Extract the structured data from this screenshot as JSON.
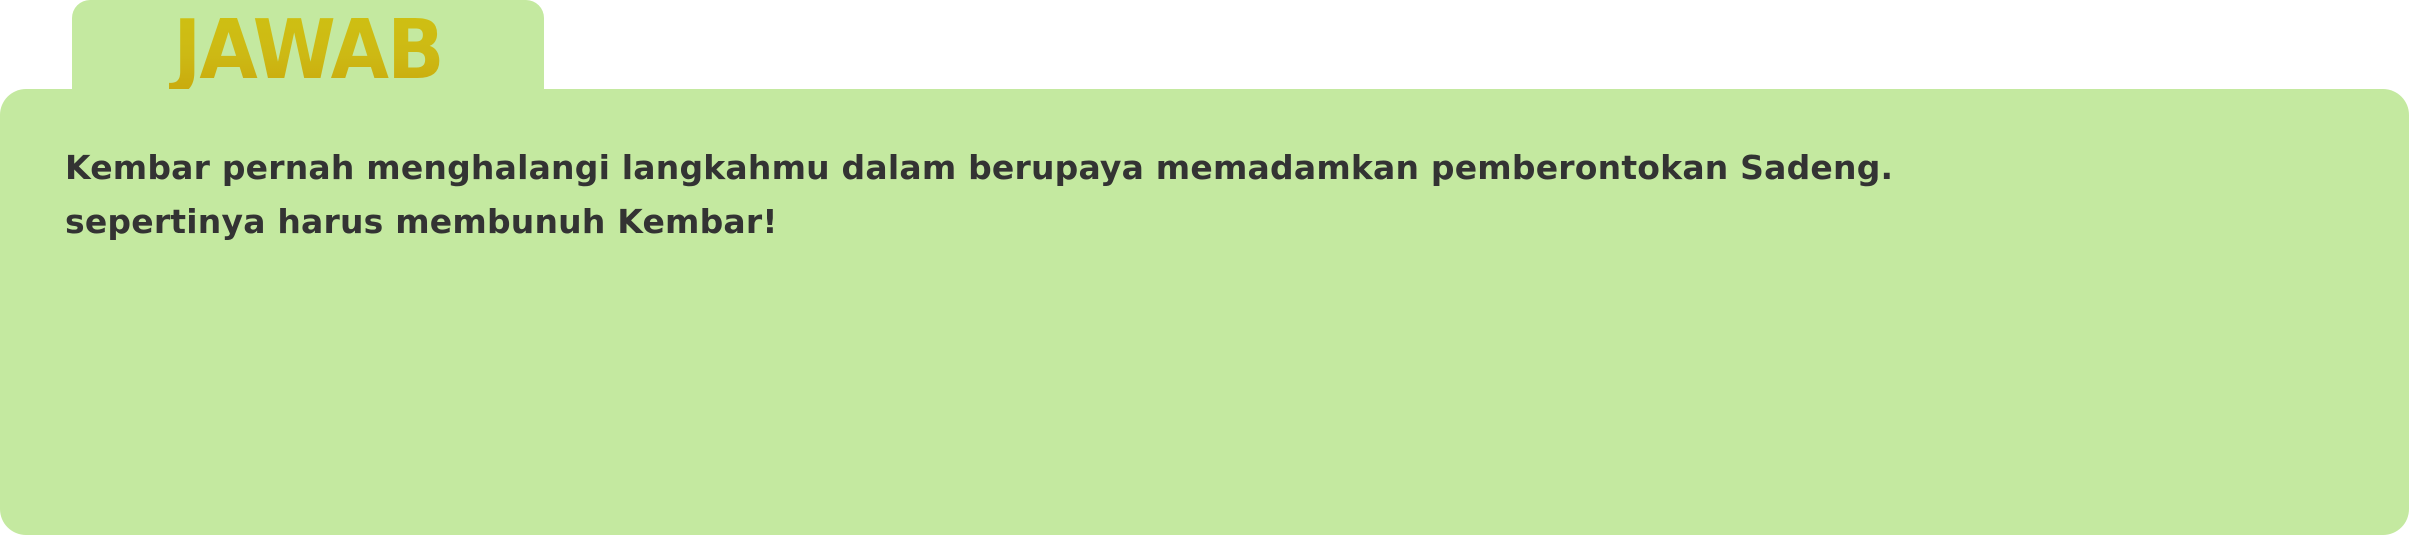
{
  "tab": {
    "title": "JAWAB"
  },
  "answer": {
    "lines": [
      "Kembar pernah menghalangi langkahmu dalam berupaya memadamkan pemberontokan Sadeng.",
      "sepertinya harus membunuh Kembar!"
    ]
  },
  "colors": {
    "panel_background": "#c4e9a0",
    "title_gold": "#cdb914",
    "text": "#333333"
  }
}
